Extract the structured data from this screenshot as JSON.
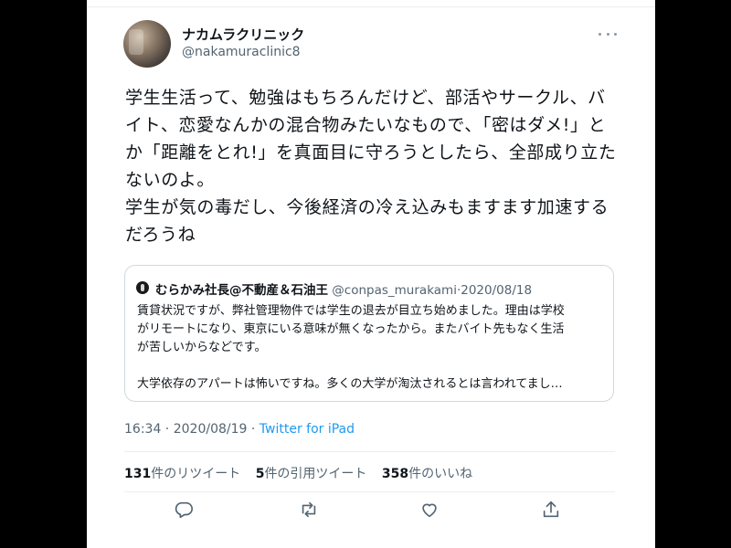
{
  "tweet": {
    "display_name": "ナカムラクリニック",
    "handle": "@nakamuraclinic8",
    "text_lines": [
      "学生生活って、勉強はもちろんだけど、部活やサークル、バ",
      "イト、恋愛なんかの混合物みたいなもので、「密はダメ!」と",
      "か「距離をとれ!」を真面目に守ろうとしたら、全部成り立た",
      "ないのよ。",
      "学生が気の毒だし、今後経済の冷え込みもますます加速する",
      "だろうね"
    ],
    "time": "16:34",
    "date": "2020/08/19",
    "source": "Twitter for iPad",
    "separator": " · "
  },
  "quote": {
    "name": "むらかみ社長@不動産＆石油王",
    "handle": "@conpas_murakami",
    "dot": "·",
    "date": "2020/08/18",
    "lines": [
      "賃貸状況ですが、弊社管理物件では学生の退去が目立ち始めました。理由は学校",
      "がリモートになり、東京にいる意味が無くなったから。またバイト先もなく生活",
      "が苦しいからなどです。",
      "",
      "大学依存のアパートは怖いですね。多くの大学が淘汰されるとは言われてまし…"
    ]
  },
  "stats": {
    "retweets_count": "131",
    "retweets_label": "件のリツイート",
    "quotes_count": "5",
    "quotes_label": "件の引用ツイート",
    "likes_count": "358",
    "likes_label": "件のいいね"
  },
  "icons": {
    "more": "more-icon",
    "reply": "reply-icon",
    "retweet": "retweet-icon",
    "like": "like-icon",
    "share": "share-icon"
  },
  "colors": {
    "link": "#1d9bf0",
    "secondary_text": "#536471",
    "border": "#cfd9de"
  }
}
